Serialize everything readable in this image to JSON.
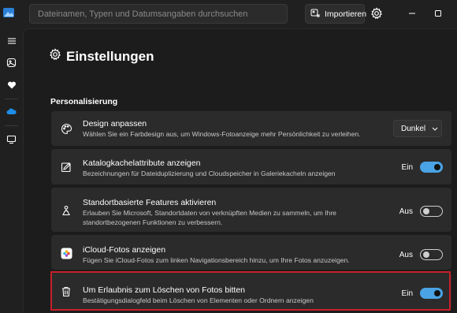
{
  "header": {
    "search_placeholder": "Dateinamen, Typen und Datumsangaben durchsuchen",
    "import_label": "Importieren"
  },
  "page": {
    "title": "Einstellungen",
    "section": "Personalisierung"
  },
  "settings": [
    {
      "icon": "palette-icon",
      "title": "Design anpassen",
      "desc": "Wählen Sie ein Farbdesign aus, um Windows-Fotoanzeige mehr Persönlichkeit zu verleihen.",
      "control": "dropdown",
      "value": "Dunkel"
    },
    {
      "icon": "edit-square-icon",
      "title": "Katalogkachelattribute anzeigen",
      "desc": "Bezeichnungen für Dateiduplizierung und Cloudspeicher in Galeriekacheln anzeigen",
      "state": "Ein",
      "on": true
    },
    {
      "icon": "location-person-icon",
      "title": "Standortbasierte Features aktivieren",
      "desc": "Erlauben Sie Microsoft, Standortdaten von verknüpften Medien zu sammeln, um Ihre standortbezogenen Funktionen zu verbessern.",
      "state": "Aus",
      "on": false
    },
    {
      "icon": "icloud-photos-icon",
      "title": "iCloud-Fotos anzeigen",
      "desc": "Fügen Sie iCloud-Fotos zum linken Navigationsbereich hinzu, um Ihre Fotos anzuzeigen.",
      "state": "Aus",
      "on": false
    },
    {
      "icon": "trash-icon",
      "title": "Um Erlaubnis zum Löschen von Fotos bitten",
      "desc": "Bestätigungsdialogfeld beim Löschen von Elementen oder Ordnern anzeigen",
      "state": "Ein",
      "on": true
    }
  ],
  "colors": {
    "accent": "#4aa3e5",
    "highlight_border": "#c8202a",
    "card_bg": "#2b2b2b",
    "app_bg": "#1c1c1c"
  }
}
